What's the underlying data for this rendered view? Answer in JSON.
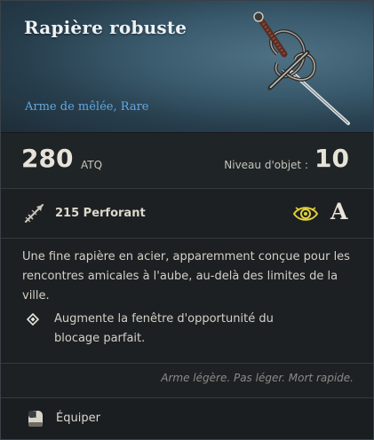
{
  "item": {
    "name": "Rapière robuste",
    "category": "Arme de mêlée, Rare",
    "weapon_art_icon": "rapier-icon"
  },
  "stats": {
    "attack_value": "280",
    "attack_unit": "ATQ",
    "item_level_label": "Niveau d'objet :",
    "item_level_value": "10"
  },
  "damage": {
    "icon": "piercing-damage-icon",
    "text": "215 Perforant",
    "scaling_attribute_icon": "perception-eye-icon",
    "scaling_grade": "A"
  },
  "description": "Une fine rapière en acier, apparemment conçue pour les rencontres amicales à l'aube, au-delà des limites de la ville.",
  "perk": {
    "icon": "diamond-icon",
    "text": "Augmente la fenêtre d'opportunité du blocage parfait."
  },
  "flavor_text": "Arme légère. Pas léger. Mort rapide.",
  "action": {
    "key_icon": "mouse-button-icon",
    "label": "Équiper"
  },
  "colors": {
    "rarity_blue": "#61a9e3",
    "header_bg": "#395a6c",
    "panel_bg": "#1c2023"
  }
}
